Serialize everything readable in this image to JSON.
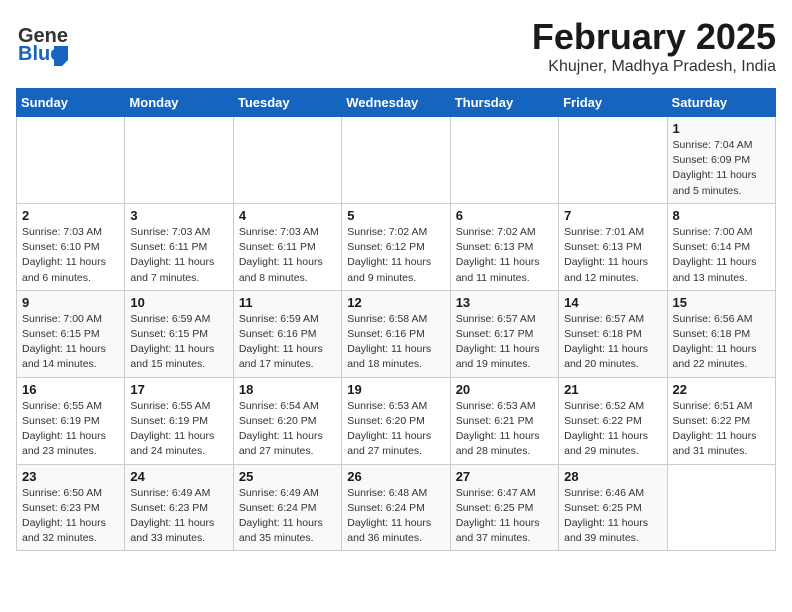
{
  "header": {
    "logo_general": "General",
    "logo_blue": "Blue",
    "title": "February 2025",
    "subtitle": "Khujner, Madhya Pradesh, India"
  },
  "weekdays": [
    "Sunday",
    "Monday",
    "Tuesday",
    "Wednesday",
    "Thursday",
    "Friday",
    "Saturday"
  ],
  "weeks": [
    [
      {
        "day": "",
        "info": ""
      },
      {
        "day": "",
        "info": ""
      },
      {
        "day": "",
        "info": ""
      },
      {
        "day": "",
        "info": ""
      },
      {
        "day": "",
        "info": ""
      },
      {
        "day": "",
        "info": ""
      },
      {
        "day": "1",
        "info": "Sunrise: 7:04 AM\nSunset: 6:09 PM\nDaylight: 11 hours\nand 5 minutes."
      }
    ],
    [
      {
        "day": "2",
        "info": "Sunrise: 7:03 AM\nSunset: 6:10 PM\nDaylight: 11 hours\nand 6 minutes."
      },
      {
        "day": "3",
        "info": "Sunrise: 7:03 AM\nSunset: 6:11 PM\nDaylight: 11 hours\nand 7 minutes."
      },
      {
        "day": "4",
        "info": "Sunrise: 7:03 AM\nSunset: 6:11 PM\nDaylight: 11 hours\nand 8 minutes."
      },
      {
        "day": "5",
        "info": "Sunrise: 7:02 AM\nSunset: 6:12 PM\nDaylight: 11 hours\nand 9 minutes."
      },
      {
        "day": "6",
        "info": "Sunrise: 7:02 AM\nSunset: 6:13 PM\nDaylight: 11 hours\nand 11 minutes."
      },
      {
        "day": "7",
        "info": "Sunrise: 7:01 AM\nSunset: 6:13 PM\nDaylight: 11 hours\nand 12 minutes."
      },
      {
        "day": "8",
        "info": "Sunrise: 7:00 AM\nSunset: 6:14 PM\nDaylight: 11 hours\nand 13 minutes."
      }
    ],
    [
      {
        "day": "9",
        "info": "Sunrise: 7:00 AM\nSunset: 6:15 PM\nDaylight: 11 hours\nand 14 minutes."
      },
      {
        "day": "10",
        "info": "Sunrise: 6:59 AM\nSunset: 6:15 PM\nDaylight: 11 hours\nand 15 minutes."
      },
      {
        "day": "11",
        "info": "Sunrise: 6:59 AM\nSunset: 6:16 PM\nDaylight: 11 hours\nand 17 minutes."
      },
      {
        "day": "12",
        "info": "Sunrise: 6:58 AM\nSunset: 6:16 PM\nDaylight: 11 hours\nand 18 minutes."
      },
      {
        "day": "13",
        "info": "Sunrise: 6:57 AM\nSunset: 6:17 PM\nDaylight: 11 hours\nand 19 minutes."
      },
      {
        "day": "14",
        "info": "Sunrise: 6:57 AM\nSunset: 6:18 PM\nDaylight: 11 hours\nand 20 minutes."
      },
      {
        "day": "15",
        "info": "Sunrise: 6:56 AM\nSunset: 6:18 PM\nDaylight: 11 hours\nand 22 minutes."
      }
    ],
    [
      {
        "day": "16",
        "info": "Sunrise: 6:55 AM\nSunset: 6:19 PM\nDaylight: 11 hours\nand 23 minutes."
      },
      {
        "day": "17",
        "info": "Sunrise: 6:55 AM\nSunset: 6:19 PM\nDaylight: 11 hours\nand 24 minutes."
      },
      {
        "day": "18",
        "info": "Sunrise: 6:54 AM\nSunset: 6:20 PM\nDaylight: 11 hours\nand 27 minutes."
      },
      {
        "day": "19",
        "info": "Sunrise: 6:53 AM\nSunset: 6:20 PM\nDaylight: 11 hours\nand 27 minutes."
      },
      {
        "day": "20",
        "info": "Sunrise: 6:53 AM\nSunset: 6:21 PM\nDaylight: 11 hours\nand 28 minutes."
      },
      {
        "day": "21",
        "info": "Sunrise: 6:52 AM\nSunset: 6:22 PM\nDaylight: 11 hours\nand 29 minutes."
      },
      {
        "day": "22",
        "info": "Sunrise: 6:51 AM\nSunset: 6:22 PM\nDaylight: 11 hours\nand 31 minutes."
      }
    ],
    [
      {
        "day": "23",
        "info": "Sunrise: 6:50 AM\nSunset: 6:23 PM\nDaylight: 11 hours\nand 32 minutes."
      },
      {
        "day": "24",
        "info": "Sunrise: 6:49 AM\nSunset: 6:23 PM\nDaylight: 11 hours\nand 33 minutes."
      },
      {
        "day": "25",
        "info": "Sunrise: 6:49 AM\nSunset: 6:24 PM\nDaylight: 11 hours\nand 35 minutes."
      },
      {
        "day": "26",
        "info": "Sunrise: 6:48 AM\nSunset: 6:24 PM\nDaylight: 11 hours\nand 36 minutes."
      },
      {
        "day": "27",
        "info": "Sunrise: 6:47 AM\nSunset: 6:25 PM\nDaylight: 11 hours\nand 37 minutes."
      },
      {
        "day": "28",
        "info": "Sunrise: 6:46 AM\nSunset: 6:25 PM\nDaylight: 11 hours\nand 39 minutes."
      },
      {
        "day": "",
        "info": ""
      }
    ]
  ]
}
